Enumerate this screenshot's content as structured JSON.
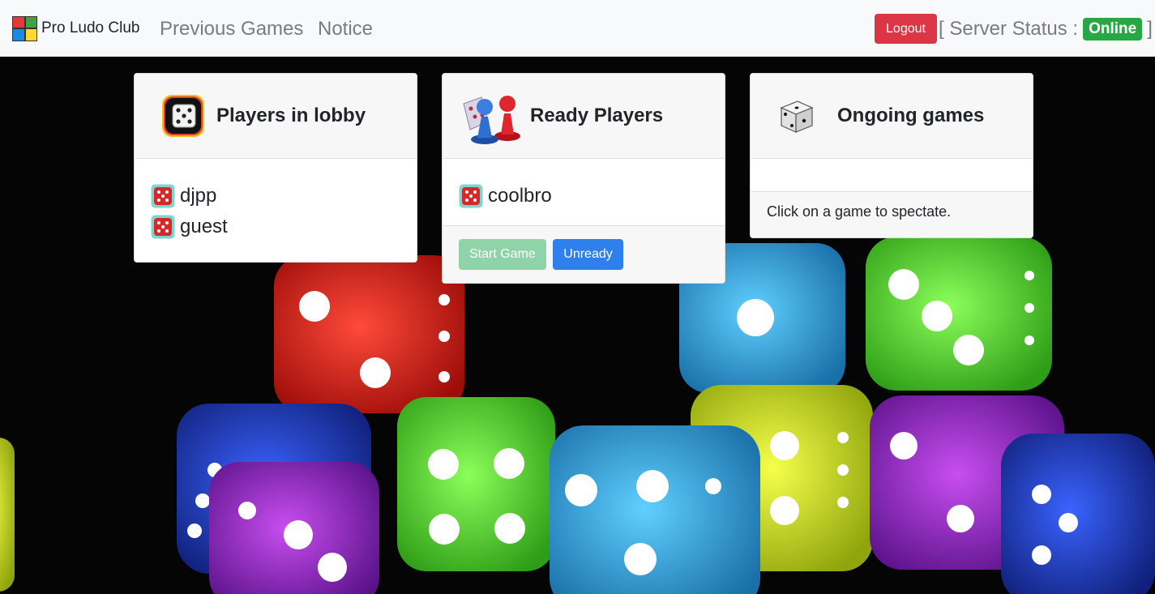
{
  "navbar": {
    "brand": "Pro Ludo Club",
    "links": [
      "Previous Games",
      "Notice"
    ],
    "logout_label": "Logout",
    "server_status_prefix": "[ Server Status :",
    "server_status_value": "Online",
    "server_status_suffix": "]",
    "status_color": "#28a745"
  },
  "lobby": {
    "title": "Players in lobby",
    "icon": "dice-icon",
    "players": [
      "djpp",
      "guest"
    ]
  },
  "ready": {
    "title": "Ready Players",
    "icon": "game-pieces-icon",
    "players": [
      "coolbro"
    ],
    "start_label": "Start Game",
    "unready_label": "Unready"
  },
  "ongoing": {
    "title": "Ongoing games",
    "icon": "die-icon",
    "hint": "Click on a game to spectate."
  },
  "colors": {
    "danger": "#dc3545",
    "primary": "#2f80ed",
    "success_disabled": "#8fd3a8"
  }
}
